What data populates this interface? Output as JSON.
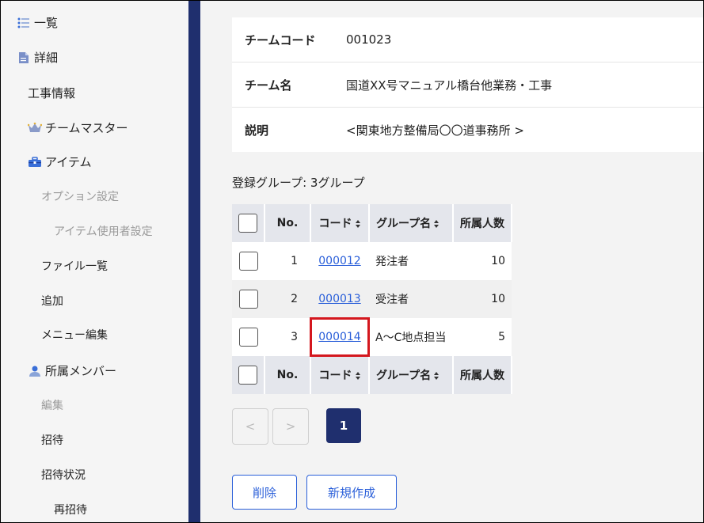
{
  "sidebar": {
    "items": [
      {
        "label": "一覧",
        "icon": "list-icon"
      },
      {
        "label": "詳細",
        "icon": "document-icon"
      },
      {
        "label": "工事情報"
      },
      {
        "label": "チームマスター",
        "icon": "crown-icon"
      },
      {
        "label": "アイテム",
        "icon": "toolbox-icon"
      },
      {
        "label": "オプション設定"
      },
      {
        "label": "アイテム使用者設定"
      },
      {
        "label": "ファイル一覧"
      },
      {
        "label": "追加"
      },
      {
        "label": "メニュー編集"
      },
      {
        "label": "所属メンバー",
        "icon": "person-icon"
      },
      {
        "label": "編集"
      },
      {
        "label": "招待"
      },
      {
        "label": "招待状況"
      },
      {
        "label": "再招待"
      }
    ]
  },
  "team": {
    "code_label": "チームコード",
    "code_value": "001023",
    "name_label": "チーム名",
    "name_value": "国道XX号マニュアル橋台他業務・工事",
    "desc_label": "説明",
    "desc_value": "<関東地方整備局〇〇道事務所 >"
  },
  "groups": {
    "count_text": "登録グループ: 3グループ",
    "headers": {
      "no": "No.",
      "code": "コード",
      "name": "グループ名",
      "members": "所属人数"
    },
    "rows": [
      {
        "no": "1",
        "code": "000012",
        "name": "発注者",
        "members": "10"
      },
      {
        "no": "2",
        "code": "000013",
        "name": "受注者",
        "members": "10"
      },
      {
        "no": "3",
        "code": "000014",
        "name": "A〜C地点担当",
        "members": "5"
      }
    ]
  },
  "pagination": {
    "prev": "<",
    "next": ">",
    "current": "1"
  },
  "actions": {
    "delete": "削除",
    "create": "新規作成"
  },
  "colors": {
    "navy": "#1f2f6e",
    "link": "#2a5fd9",
    "highlight": "#d4171e"
  }
}
